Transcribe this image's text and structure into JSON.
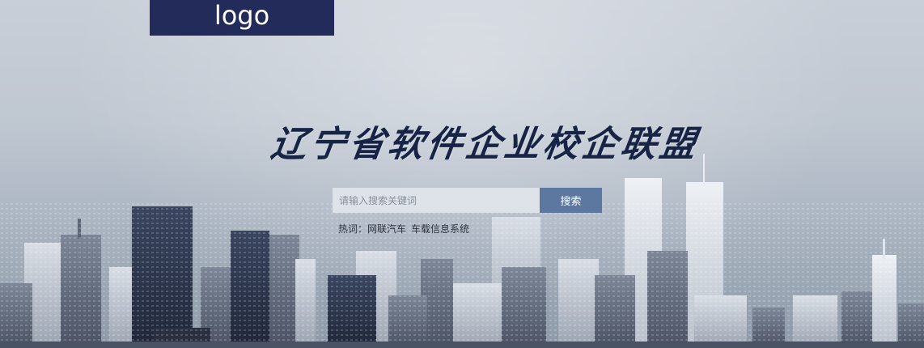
{
  "header": {
    "logo_text": "logo"
  },
  "hero": {
    "title": "辽宁省软件企业校企联盟"
  },
  "search": {
    "placeholder": "请输入搜索关键词",
    "button_label": "搜索"
  },
  "hot_words": {
    "label": "热词：",
    "items": [
      "网联汽车",
      "车载信息系统"
    ]
  },
  "colors": {
    "logo_background": "#232b5a",
    "title_text": "#172445",
    "search_button": "#5c78a0",
    "search_input_background": "#dee3ea"
  }
}
